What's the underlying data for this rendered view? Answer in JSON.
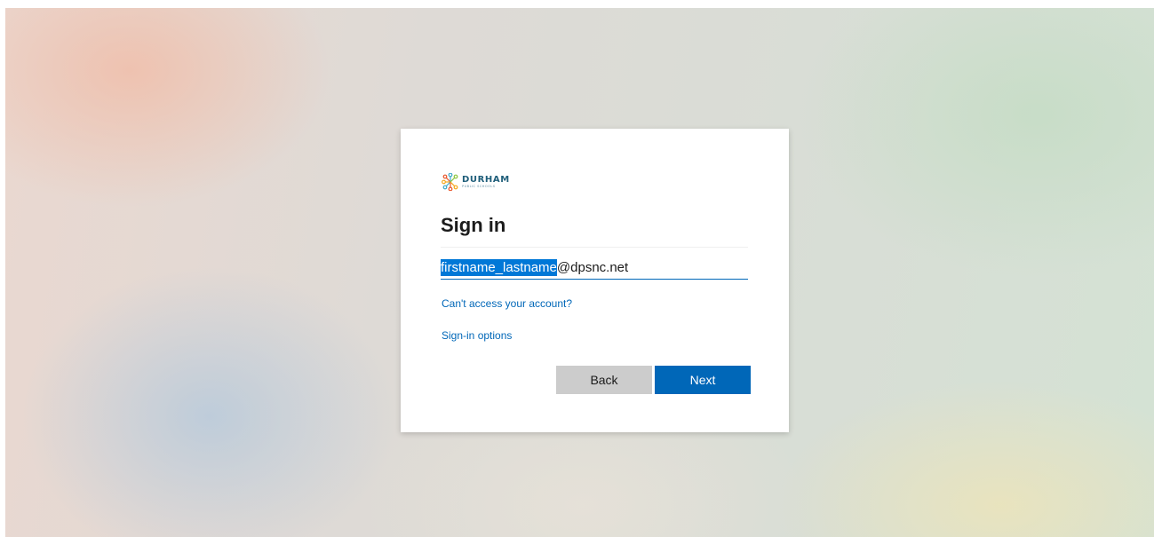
{
  "logo": {
    "name": "DURHAM",
    "subtitle": "PUBLIC SCHOOLS"
  },
  "signin": {
    "title": "Sign in",
    "email": {
      "selected": "firstname_lastname",
      "suffix": "@dpsnc.net"
    },
    "cant_access_link": "Can't access your account?",
    "signin_options_link": "Sign-in options",
    "back_label": "Back",
    "next_label": "Next"
  },
  "colors": {
    "accent": "#0067b8",
    "selection": "#0078d7",
    "back_button": "#cccccc"
  }
}
